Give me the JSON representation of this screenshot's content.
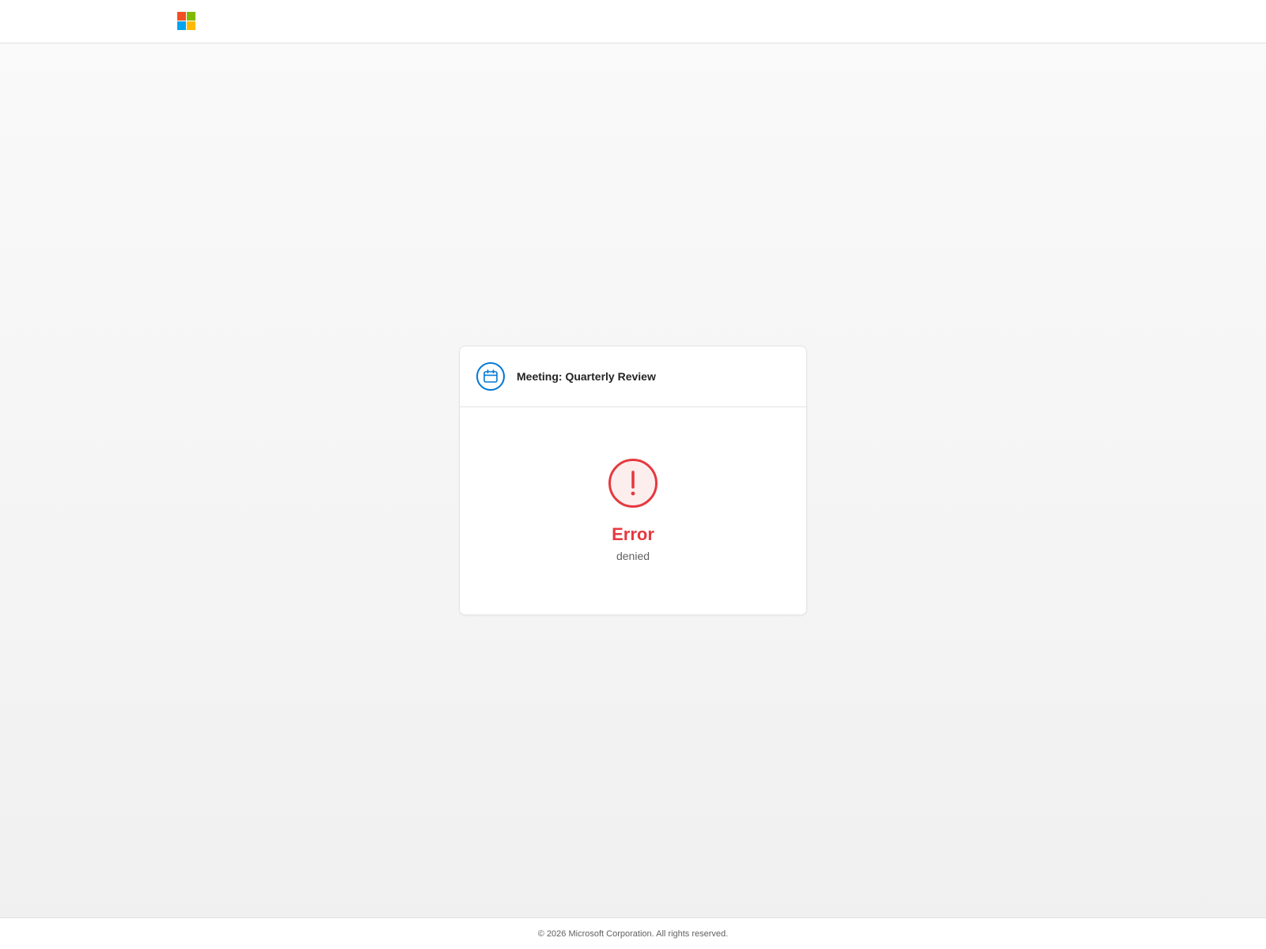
{
  "header": {
    "logo_icon": "microsoft-logo-icon",
    "logo_colors": [
      "#f25022",
      "#7fba00",
      "#00a4ef",
      "#ffb900"
    ]
  },
  "card": {
    "icon": "calendar-icon",
    "title": "Meeting: Quarterly Review",
    "error": {
      "icon": "exclamation-icon",
      "title": "Error",
      "message": "denied",
      "color": "#e5393f"
    },
    "accent_color": "#0078d4"
  },
  "footer": {
    "text": "© 2026 Microsoft Corporation. All rights reserved."
  }
}
